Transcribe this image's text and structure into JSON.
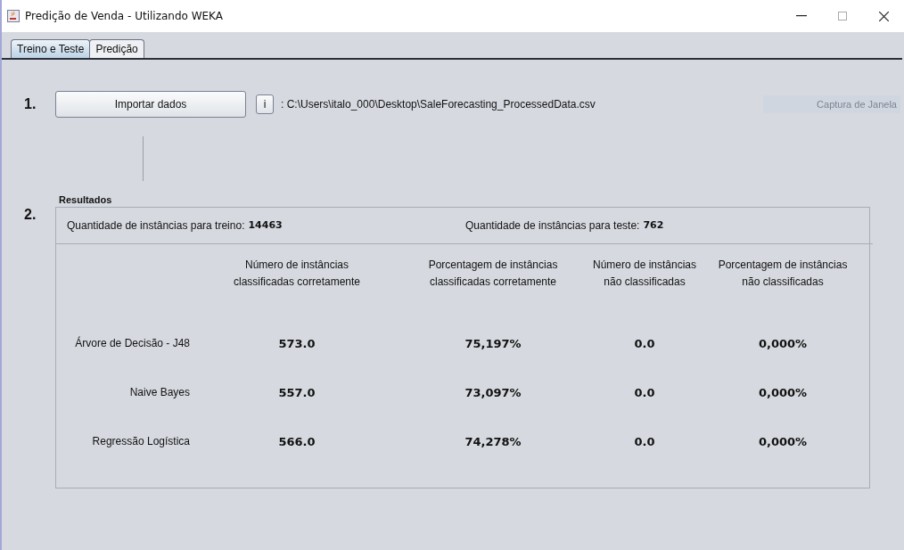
{
  "window": {
    "title": "Predição de Venda - Utilizando WEKA"
  },
  "tabs": [
    {
      "label": "Treino e Teste",
      "selected": true
    },
    {
      "label": "Predição",
      "selected": false
    }
  ],
  "step_1": {
    "number": "1.",
    "button": "Importar dados",
    "info_button": "i",
    "file_path": ": C:\\Users\\italo_000\\Desktop\\SaleForecasting_ProcessedData.csv"
  },
  "overlay_label": "Captura de Janela",
  "step_2": {
    "number": "2.",
    "title": "Resultados",
    "train_label": "Quantidade de instâncias para treino:",
    "train_count": "14463",
    "test_label": "Quantidade de instâncias para teste:",
    "test_count": "762",
    "table": {
      "columns": [
        "Número de instâncias classificadas corretamente",
        "Porcentagem de instâncias classificadas corretamente",
        "Número de instâncias não classificadas",
        "Porcentagem de instâncias não classificadas"
      ],
      "rows": [
        {
          "name": "Árvore de Decisão - J48",
          "values": [
            "573.0",
            "75,197%",
            "0.0",
            "0,000%"
          ]
        },
        {
          "name": "Naive Bayes",
          "values": [
            "557.0",
            "73,097%",
            "0.0",
            "0,000%"
          ]
        },
        {
          "name": "Regressão Logística",
          "values": [
            "566.0",
            "74,278%",
            "0.0",
            "0,000%"
          ]
        }
      ]
    }
  }
}
